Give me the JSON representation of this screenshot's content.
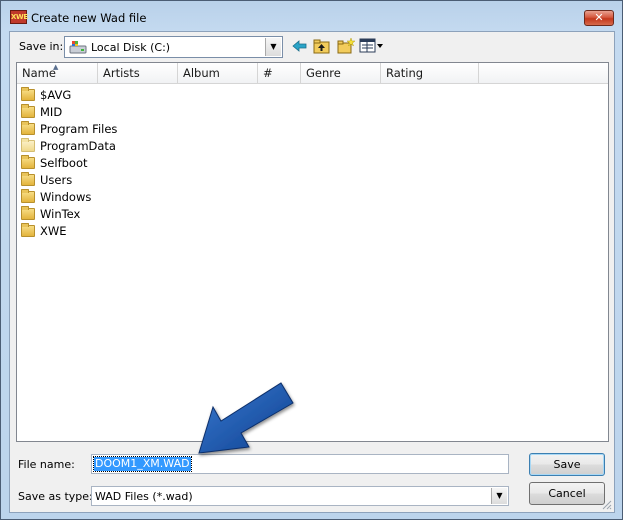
{
  "window": {
    "title": "Create new Wad file",
    "app_icon_text": "XWE",
    "close_glyph": "✕"
  },
  "toolbar": {
    "save_in_label": "Save in:",
    "save_in_value": "Local Disk (C:)",
    "icons": [
      "back-icon",
      "up-folder-icon",
      "new-folder-icon",
      "view-menu-icon"
    ]
  },
  "columns": [
    "Name",
    "Artists",
    "Album",
    "#",
    "Genre",
    "Rating"
  ],
  "files": [
    {
      "name": "$AVG",
      "style": "normal"
    },
    {
      "name": "MID",
      "style": "normal"
    },
    {
      "name": "Program Files",
      "style": "normal"
    },
    {
      "name": "ProgramData",
      "style": "light"
    },
    {
      "name": "Selfboot",
      "style": "normal"
    },
    {
      "name": "Users",
      "style": "normal"
    },
    {
      "name": "Windows",
      "style": "normal"
    },
    {
      "name": "WinTex",
      "style": "normal"
    },
    {
      "name": "XWE",
      "style": "normal"
    }
  ],
  "form": {
    "file_name_label": "File name:",
    "file_name_value": "DOOM1_XM.WAD",
    "save_type_label": "Save as type:",
    "save_type_value": "WAD Files (*.wad)"
  },
  "buttons": {
    "save": "Save",
    "cancel": "Cancel"
  },
  "colors": {
    "selection": "#3399ff",
    "arrow": "#1f5fb0"
  }
}
